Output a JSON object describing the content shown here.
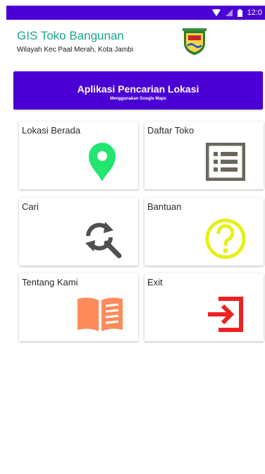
{
  "status_bar": {
    "time": "12:0"
  },
  "header": {
    "title": "GIS Toko Bangunan",
    "subtitle": "Wilayah Kec Paal Merah, Kota Jambi"
  },
  "banner": {
    "title": "Aplikasi Pencarian Lokasi",
    "subtitle": "Menggunakan Google Maps"
  },
  "menu": [
    {
      "label": "Lokasi Berada",
      "icon": "location-pin-icon",
      "color": "#22e66f"
    },
    {
      "label": "Daftar Toko",
      "icon": "list-icon",
      "color": "#6b675f"
    },
    {
      "label": "Cari",
      "icon": "search-refresh-icon",
      "color": "#505050"
    },
    {
      "label": "Bantuan",
      "icon": "help-circle-icon",
      "color": "#e5f01a"
    },
    {
      "label": "Tentang Kami",
      "icon": "open-book-icon",
      "color": "#ff8a5b"
    },
    {
      "label": "Exit",
      "icon": "exit-icon",
      "color": "#ee2222"
    }
  ],
  "colors": {
    "primary": "#4a00d4",
    "title_teal": "#1aa58d"
  }
}
